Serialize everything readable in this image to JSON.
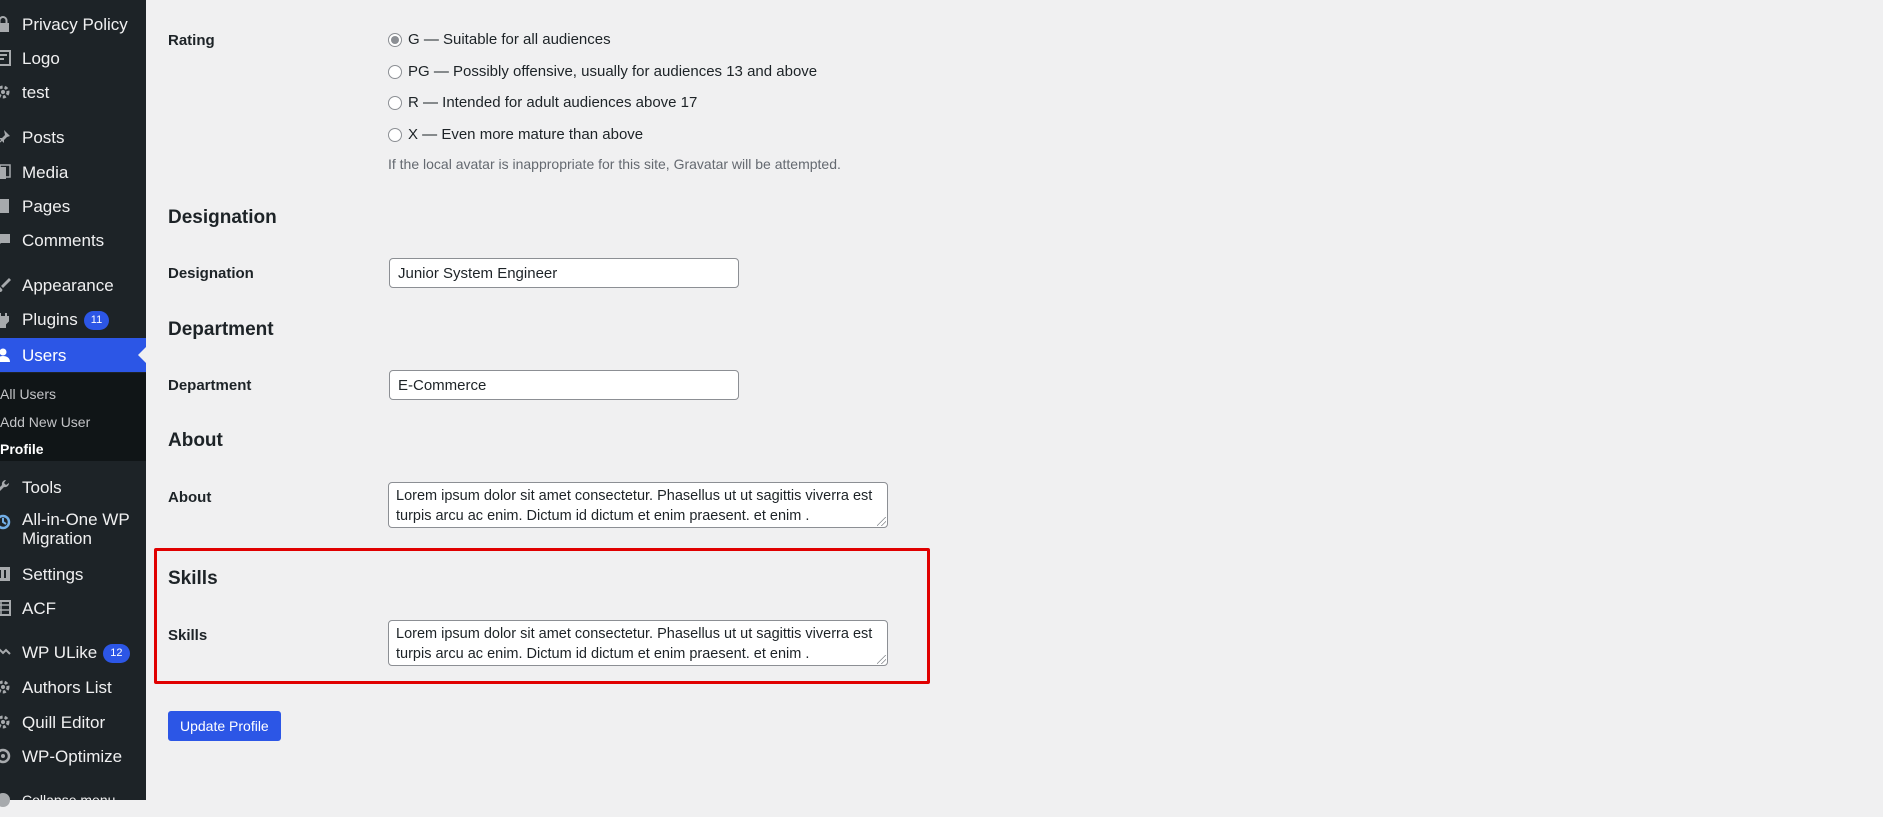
{
  "sidebar": {
    "items": [
      {
        "label": "Privacy Policy",
        "icon": "lock-icon"
      },
      {
        "label": "Logo",
        "icon": "form-icon"
      },
      {
        "label": "test",
        "icon": "gear-icon"
      },
      {
        "label": "Posts",
        "icon": "pin-icon"
      },
      {
        "label": "Media",
        "icon": "media-icon"
      },
      {
        "label": "Pages",
        "icon": "page-icon"
      },
      {
        "label": "Comments",
        "icon": "comment-icon"
      },
      {
        "label": "Appearance",
        "icon": "brush-icon"
      },
      {
        "label": "Plugins",
        "icon": "plugin-icon",
        "badge": "11"
      },
      {
        "label": "Users",
        "icon": "user-icon",
        "active": true
      },
      {
        "label": "Tools",
        "icon": "wrench-icon"
      },
      {
        "label": "All-in-One WP Migration",
        "icon": "migration-icon"
      },
      {
        "label": "Settings",
        "icon": "settings-icon"
      },
      {
        "label": "ACF",
        "icon": "acf-icon"
      },
      {
        "label": "WP ULike",
        "icon": "ulike-icon",
        "badge": "12"
      },
      {
        "label": "Authors List",
        "icon": "gear-icon"
      },
      {
        "label": "Quill Editor",
        "icon": "gear-icon"
      },
      {
        "label": "WP-Optimize",
        "icon": "optimize-icon"
      },
      {
        "label": "Collapse menu",
        "icon": "collapse-icon"
      }
    ],
    "submenu": [
      {
        "label": "All Users"
      },
      {
        "label": "Add New User"
      },
      {
        "label": "Profile",
        "current": true
      }
    ]
  },
  "rating": {
    "label": "Rating",
    "options": [
      {
        "label": "G — Suitable for all audiences",
        "checked": true
      },
      {
        "label": "PG — Possibly offensive, usually for audiences 13 and above",
        "checked": false
      },
      {
        "label": "R — Intended for adult audiences above 17",
        "checked": false
      },
      {
        "label": "X — Even more mature than above",
        "checked": false
      }
    ],
    "description": "If the local avatar is inappropriate for this site, Gravatar will be attempted."
  },
  "designation": {
    "heading": "Designation",
    "label": "Designation",
    "value": "Junior System Engineer"
  },
  "department": {
    "heading": "Department",
    "label": "Department",
    "value": "E-Commerce"
  },
  "about": {
    "heading": "About",
    "label": "About",
    "value": "Lorem ipsum dolor sit amet consectetur. Phasellus ut ut sagittis viverra est turpis arcu ac enim. Dictum id dictum et enim praesent. et enim ."
  },
  "skills": {
    "heading": "Skills",
    "label": "Skills",
    "value": "Lorem ipsum dolor sit amet consectetur. Phasellus ut ut sagittis viverra est turpis arcu ac enim. Dictum id dictum et enim praesent. et enim ."
  },
  "update_button": "Update Profile",
  "colors": {
    "accent": "#2c56e6",
    "sidebar_bg": "#1d2327",
    "highlight": "#e00000",
    "page_bg": "#f0f0f1"
  }
}
